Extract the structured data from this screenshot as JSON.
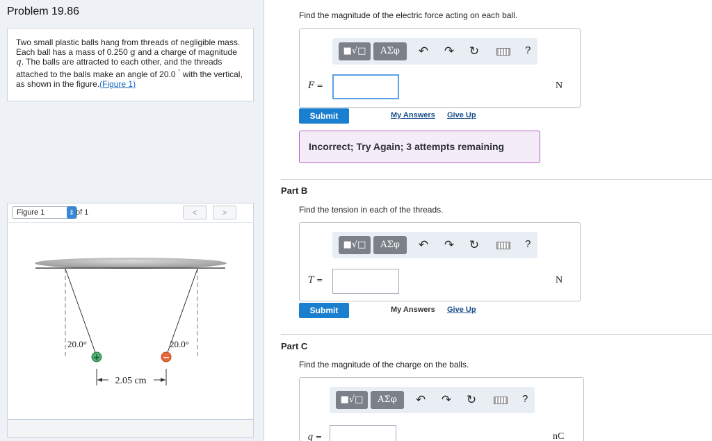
{
  "problem": {
    "title": "Problem 19.86",
    "text_a": "Two small plastic balls hang from threads of negligible mass. Each ball has a mass of 0.250 ",
    "text_unit": "g",
    "text_b": " and a charge of magnitude ",
    "text_var": "q",
    "text_c": ". The balls are attracted to each other, and the threads attached to the balls make an angle of 20.0 ",
    "text_deg": "°",
    "text_d": " with the vertical, as shown in the figure.",
    "figure_link": "(Figure 1)"
  },
  "figure": {
    "select_value": "Figure 1",
    "of_label": "of 1",
    "prev": "<",
    "next": ">",
    "angle_left": "20.0°",
    "angle_right": "20.0°",
    "distance": "2.05 cm",
    "plus_sign": "+",
    "minus_sign": "−",
    "colors": {
      "positive": "#4caf6e",
      "negative": "#e8693b",
      "ceiling": "#bdbdbd"
    }
  },
  "toolbar": {
    "template_label": "■√□",
    "greek_label": "ΑΣφ",
    "undo_icon": "undo-icon",
    "redo_icon": "redo-icon",
    "reset_icon": "reset-icon",
    "keyboard_icon": "keyboard-icon",
    "help_label": "?"
  },
  "partA": {
    "question": "Find the magnitude of the electric force acting on each ball.",
    "var": "F",
    "eq": " =",
    "unit": "N",
    "submit": "Submit",
    "my_answers": "My Answers",
    "give_up": "Give Up",
    "feedback": "Incorrect; Try Again; 3 attempts remaining"
  },
  "partB": {
    "label": "Part B",
    "question": "Find the tension in each of the threads.",
    "var": "T",
    "eq": " =",
    "unit": "N",
    "submit": "Submit",
    "my_answers": "My Answers",
    "give_up": "Give Up"
  },
  "partC": {
    "label": "Part C",
    "question": "Find the magnitude of the charge on the balls.",
    "var": "q",
    "eq": " =",
    "unit": "nC"
  }
}
